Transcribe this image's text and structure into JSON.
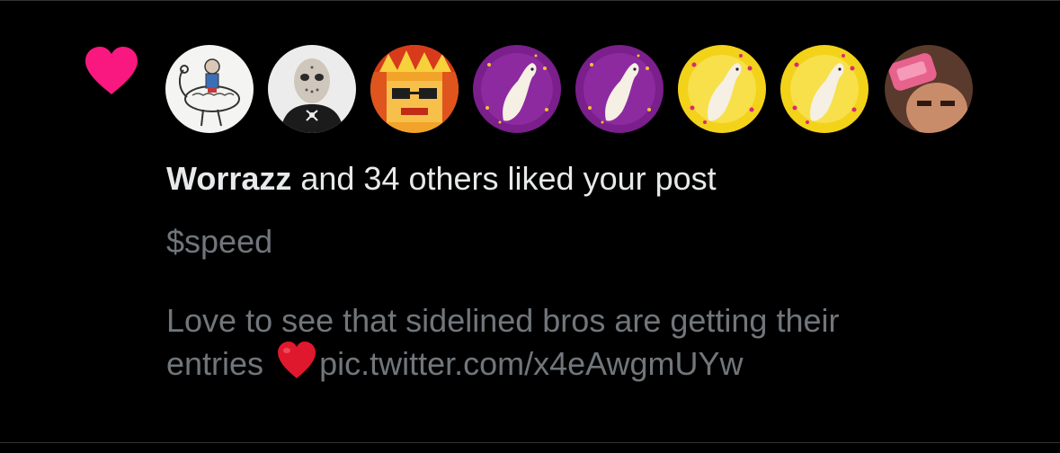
{
  "notification": {
    "type_icon": "heart-icon",
    "accent_color": "#f91880",
    "avatars": [
      {
        "name": "avatar-emu-rider",
        "description_icon": "emu-drawing"
      },
      {
        "name": "avatar-hockey-mask",
        "description_icon": "masked-figure"
      },
      {
        "name": "avatar-pixel-face",
        "description_icon": "fiery-face"
      },
      {
        "name": "avatar-dog-purple-1",
        "description_icon": "white-dog"
      },
      {
        "name": "avatar-dog-purple-2",
        "description_icon": "white-dog"
      },
      {
        "name": "avatar-dog-yellow-1",
        "description_icon": "white-dog"
      },
      {
        "name": "avatar-dog-yellow-2",
        "description_icon": "white-dog"
      },
      {
        "name": "avatar-soap-club",
        "description_icon": "soap-bar"
      }
    ],
    "headline_user": "Worrazz",
    "headline_rest": " and 34 others liked your post",
    "post": {
      "line1": "$speed",
      "line2": "Love to see that sidelined bros are getting their",
      "line3_before": "entries",
      "line3_emoji": "red-heart-emoji",
      "line3_link": "pic.twitter.com/x4eAwgmUYw"
    }
  }
}
